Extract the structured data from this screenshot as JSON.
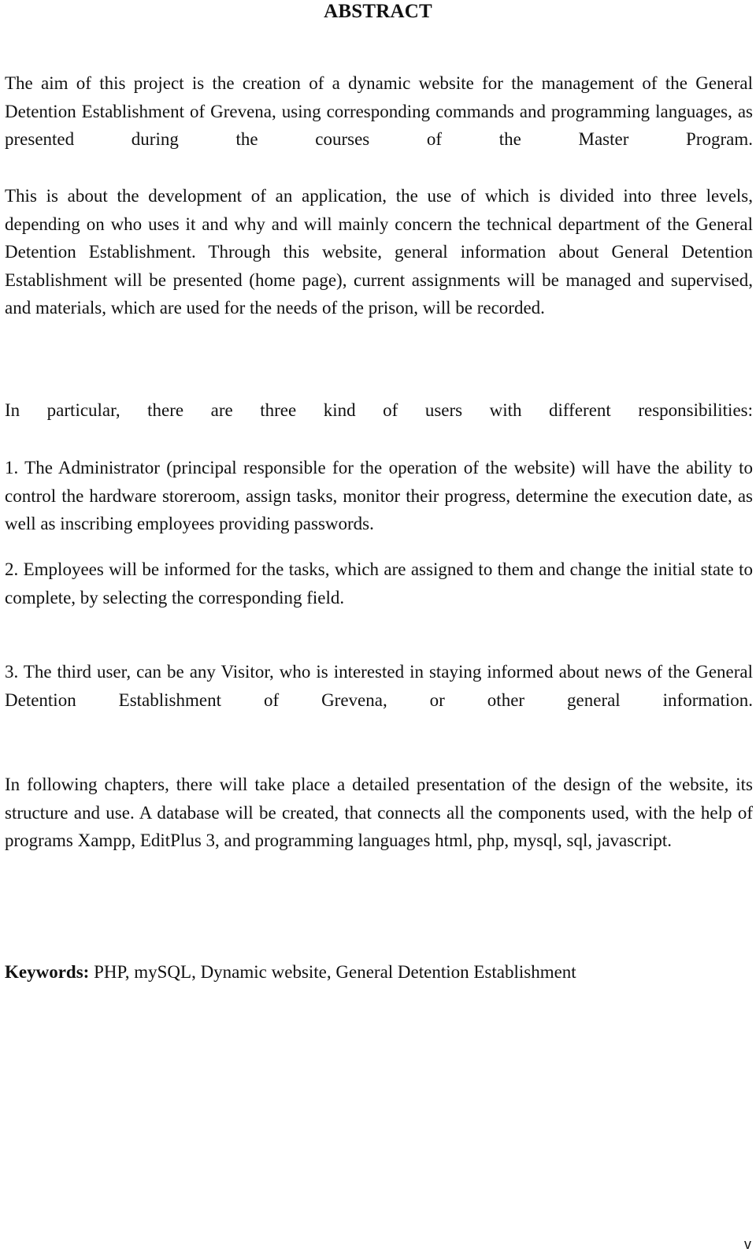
{
  "document": {
    "title": "ABSTRACT",
    "paragraphs": [
      "The aim of this project is the creation of a dynamic website for the management of the General Detention Establishment of Grevena, using corresponding commands and programming languages, as presented during the courses of the Master Program.",
      "This is about the development of   an application, the use of which is divided into three levels, depending on who uses it and why and will mainly concern the technical department of the General Detention Establishment. Through this website, general information about General Detention Establishment will be presented (home page), current assignments will be managed and supervised, and materials, which are used for the needs of the prison, will be recorded.",
      "In particular, there are three kind of users with different responsibilities:",
      "1. The Administrator (principal responsible for the operation of the website) will have the ability to control the hardware storeroom, assign tasks, monitor their progress, determine the execution date, as well as inscribing employees providing passwords.",
      "2. Employees will be informed for the tasks, which are assigned to them and change the initial state to complete, by selecting the corresponding field.",
      "3. The third user, can be any Visitor, who is interested in staying informed about news of the General Detention Establishment of Grevena, or other general information.",
      "In following chapters, there will take place a detailed presentation of the design of the website, its structure and use. A database will be created, that connects all the components used, with the help of programs Xampp, EditPlus 3, and programming languages html, php, mysql, sql, javascript."
    ],
    "keywords": {
      "label": "Keywords:",
      "value": " PHP, mySQL, Dynamic website, General Detention Establishment"
    },
    "page_number": "v"
  }
}
